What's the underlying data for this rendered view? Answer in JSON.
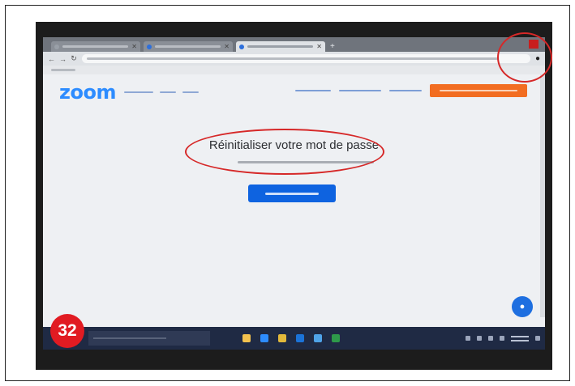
{
  "page": {
    "badge_number": "32",
    "headline": "Réinitialiser votre mot de passe"
  },
  "zoom_page": {
    "logo": "zoom"
  },
  "colors": {
    "zoom_blue": "#2d8cff",
    "signup_orange": "#f26d21",
    "primary_button": "#0e63e0",
    "annotation_red": "#d62828",
    "badge_red": "#e11b22",
    "taskbar": "#1f2a44"
  },
  "icons": {
    "chat": "chat-bubble-icon",
    "profile": "user-profile-icon",
    "back": "arrow-left-icon",
    "forward": "arrow-right-icon",
    "reload": "reload-icon"
  }
}
